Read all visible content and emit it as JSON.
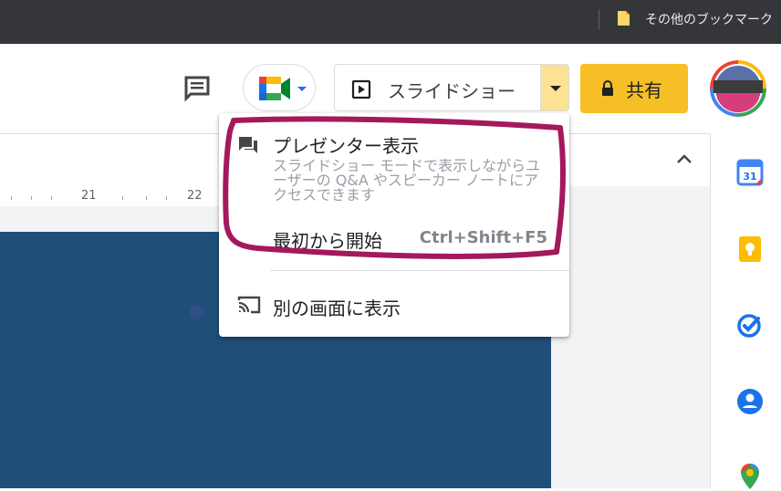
{
  "bookmarks_bar": {
    "other_bookmarks_label": "その他のブックマーク"
  },
  "header": {
    "slideshow_label": "スライドショー",
    "share_label": "共有"
  },
  "ruler": {
    "labels": [
      "21",
      "22"
    ]
  },
  "slideshow_menu": {
    "presenter_view": {
      "title": "プレゼンター表示",
      "description": "スライドショー モードで表示しながらユーザーの Q&A やスピーカー ノートにアクセスできます"
    },
    "from_beginning": {
      "title": "最初から開始",
      "shortcut": "Ctrl+Shift+F5"
    },
    "present_on_other_screen": {
      "title": "別の画面に表示"
    }
  },
  "colors": {
    "share_button": "#f6bf26",
    "caret_button": "#fde293",
    "slide_background": "#1f4e79",
    "highlight_outline": "#a3195b"
  }
}
